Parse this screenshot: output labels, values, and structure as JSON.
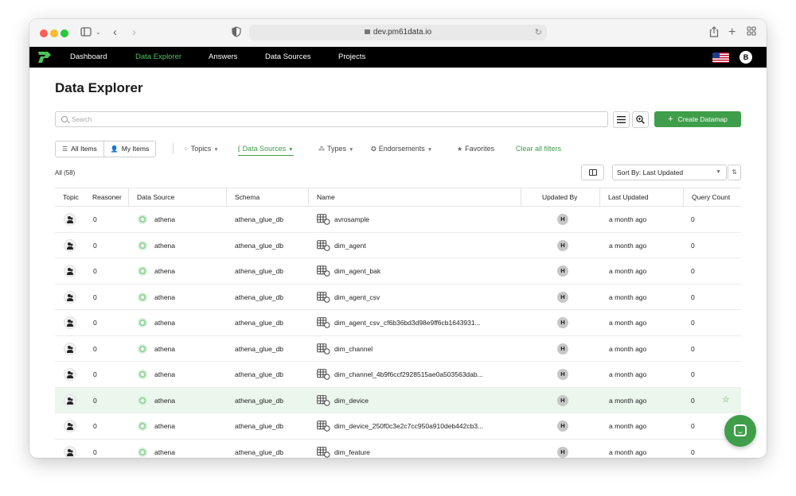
{
  "browser": {
    "url": "dev.pm61data.io"
  },
  "nav": {
    "items": [
      {
        "label": "Dashboard",
        "active": false
      },
      {
        "label": "Data Explorer",
        "active": true
      },
      {
        "label": "Answers",
        "active": false
      },
      {
        "label": "Data Sources",
        "active": false
      },
      {
        "label": "Projects",
        "active": false
      }
    ],
    "user_initial": "B"
  },
  "page": {
    "title": "Data Explorer"
  },
  "search": {
    "placeholder": "Search",
    "value": ""
  },
  "toolbar": {
    "create_label": "Create Datamap"
  },
  "scope": {
    "all_items": "All Items",
    "my_items": "My Items"
  },
  "filters": {
    "topics": "Topics",
    "data_sources": "Data Sources",
    "types": "Types",
    "endorsements": "Endorsements",
    "favorites": "Favorites",
    "clear_all": "Clear all filters"
  },
  "results": {
    "count_label": "All (58)",
    "sort_label": "Sort By: Last Updated"
  },
  "table": {
    "columns": [
      "Topic",
      "Reasoner",
      "Data Source",
      "Schema",
      "Name",
      "Updated By",
      "Last Updated",
      "Query Count"
    ],
    "rows": [
      {
        "reasoner": "0",
        "source": "athena",
        "schema": "athena_glue_db",
        "name": "avrosample",
        "updated_by": "H",
        "last_updated": "a month ago",
        "query_count": "0",
        "highlighted": false
      },
      {
        "reasoner": "0",
        "source": "athena",
        "schema": "athena_glue_db",
        "name": "dim_agent",
        "updated_by": "H",
        "last_updated": "a month ago",
        "query_count": "0",
        "highlighted": false
      },
      {
        "reasoner": "0",
        "source": "athena",
        "schema": "athena_glue_db",
        "name": "dim_agent_bak",
        "updated_by": "H",
        "last_updated": "a month ago",
        "query_count": "0",
        "highlighted": false
      },
      {
        "reasoner": "0",
        "source": "athena",
        "schema": "athena_glue_db",
        "name": "dim_agent_csv",
        "updated_by": "H",
        "last_updated": "a month ago",
        "query_count": "0",
        "highlighted": false
      },
      {
        "reasoner": "0",
        "source": "athena",
        "schema": "athena_glue_db",
        "name": "dim_agent_csv_cf6b36bd3d98e9ff6cb1643931...",
        "updated_by": "H",
        "last_updated": "a month ago",
        "query_count": "0",
        "highlighted": false
      },
      {
        "reasoner": "0",
        "source": "athena",
        "schema": "athena_glue_db",
        "name": "dim_channel",
        "updated_by": "H",
        "last_updated": "a month ago",
        "query_count": "0",
        "highlighted": false
      },
      {
        "reasoner": "0",
        "source": "athena",
        "schema": "athena_glue_db",
        "name": "dim_channel_4b9f6ccf2928515ae0a503563dab...",
        "updated_by": "H",
        "last_updated": "a month ago",
        "query_count": "0",
        "highlighted": false
      },
      {
        "reasoner": "0",
        "source": "athena",
        "schema": "athena_glue_db",
        "name": "dim_device",
        "updated_by": "H",
        "last_updated": "a month ago",
        "query_count": "0",
        "highlighted": true
      },
      {
        "reasoner": "0",
        "source": "athena",
        "schema": "athena_glue_db",
        "name": "dim_device_250f0c3e2c7cc950a910deb442cb3...",
        "updated_by": "H",
        "last_updated": "a month ago",
        "query_count": "0",
        "highlighted": false
      },
      {
        "reasoner": "0",
        "source": "athena",
        "schema": "athena_glue_db",
        "name": "dim_feature",
        "updated_by": "H",
        "last_updated": "a month ago",
        "query_count": "0",
        "highlighted": false
      }
    ]
  },
  "colors": {
    "accent": "#3f9e4a",
    "nav_active": "#4cc35a",
    "row_highlight": "#ebf6ec"
  }
}
